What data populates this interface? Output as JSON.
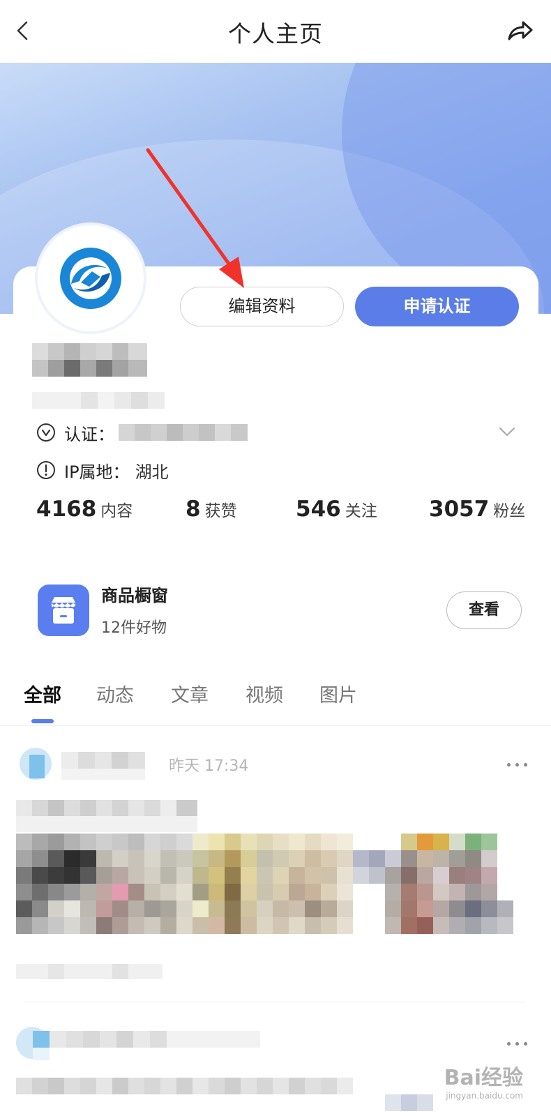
{
  "header": {
    "title": "个人主页",
    "back_icon": "chevron-left-icon",
    "share_icon": "share-arrow-icon"
  },
  "profile": {
    "edit_button": "编辑资料",
    "certify_button": "申请认证",
    "certification_label": "认证：",
    "ip_label": "IP属地：",
    "ip_value": "湖北",
    "stats": [
      {
        "value": "4168",
        "label": "内容"
      },
      {
        "value": "8",
        "label": "获赞"
      },
      {
        "value": "546",
        "label": "关注"
      },
      {
        "value": "3057",
        "label": "粉丝"
      }
    ]
  },
  "store": {
    "title": "商品橱窗",
    "subtitle": "12件好物",
    "view_button": "查看"
  },
  "tabs": [
    "全部",
    "动态",
    "文章",
    "视频",
    "图片"
  ],
  "feed": {
    "post_time": "昨天 17:34"
  },
  "watermark": {
    "brand": "Bai经验",
    "url": "jingyan.baidu.com"
  },
  "colors": {
    "accent": "#5b7de8",
    "annotation_arrow": "#f0322b"
  }
}
